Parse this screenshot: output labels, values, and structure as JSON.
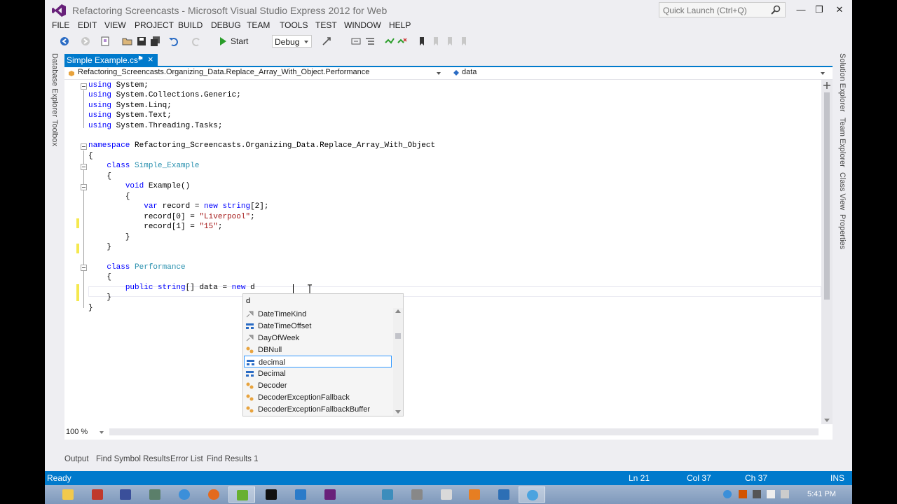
{
  "title": "Refactoring Screencasts - Microsoft Visual Studio Express 2012 for Web",
  "quick_launch_placeholder": "Quick Launch (Ctrl+Q)",
  "menu": [
    "FILE",
    "EDIT",
    "VIEW",
    "PROJECT",
    "BUILD",
    "DEBUG",
    "TEAM",
    "TOOLS",
    "TEST",
    "WINDOW",
    "HELP"
  ],
  "toolbar": {
    "start_label": "Start",
    "config": "Debug"
  },
  "left_tool_tabs": [
    "Database Explorer",
    "Toolbox"
  ],
  "right_tool_tabs": [
    "Solution Explorer",
    "Team Explorer",
    "Class View",
    "Properties"
  ],
  "document_tab": {
    "label": "Simple Example.cs*"
  },
  "navbar": {
    "type_dropdown": "Refactoring_Screencasts.Organizing_Data.Replace_Array_With_Object.Performance",
    "member_dropdown": "data"
  },
  "code": {
    "l1_kw": "using",
    "l1_rest": " System;",
    "l2_kw": "using",
    "l2_rest": " System.Collections.Generic;",
    "l3_kw": "using",
    "l3_rest": " System.Linq;",
    "l4_kw": "using",
    "l4_rest": " System.Text;",
    "l5_kw": "using",
    "l5_rest": " System.Threading.Tasks;",
    "l7_kw": "namespace",
    "l7_rest": " Refactoring_Screencasts.Organizing_Data.Replace_Array_With_Object",
    "l8": "{",
    "l9_kw": "class",
    "l9_type": "Simple_Example",
    "l10": "{",
    "l11_kw": "void",
    "l11_rest": " Example()",
    "l12": "{",
    "l13_kw1": "var",
    "l13_mid1": " record = ",
    "l13_kw2": "new",
    "l13_sp": " ",
    "l13_kw3": "string",
    "l13_end": "[2];",
    "l14_pre": "record[0] = ",
    "l14_str": "\"Liverpool\"",
    "l14_end": ";",
    "l15_pre": "record[1] = ",
    "l15_str": "\"15\"",
    "l15_end": ";",
    "l16": "}",
    "l17": "}",
    "l19_kw": "class",
    "l19_type": "Performance",
    "l20": "{",
    "l21_kw1": "public",
    "l21_sp": " ",
    "l21_kw2": "string",
    "l21_mid": "[] data = ",
    "l21_kw3": "new",
    "l21_end": " d",
    "l22": "}",
    "l23": "}"
  },
  "intellisense": {
    "typed": "d",
    "items": [
      {
        "label": "DateTimeKind",
        "icon": "enum-icon"
      },
      {
        "label": "DateTimeOffset",
        "icon": "struct-icon"
      },
      {
        "label": "DayOfWeek",
        "icon": "enum-icon"
      },
      {
        "label": "DBNull",
        "icon": "class-icon"
      },
      {
        "label": "decimal",
        "icon": "struct-icon",
        "selected": true
      },
      {
        "label": "Decimal",
        "icon": "struct-icon"
      },
      {
        "label": "Decoder",
        "icon": "class-icon"
      },
      {
        "label": "DecoderExceptionFallback",
        "icon": "class-icon"
      },
      {
        "label": "DecoderExceptionFallbackBuffer",
        "icon": "class-icon"
      }
    ]
  },
  "zoom": "100 %",
  "bottom_tabs": [
    "Output",
    "Find Symbol Results",
    "Error List",
    "Find Results 1"
  ],
  "status": {
    "ready": "Ready",
    "line": "Ln 21",
    "col": "Col 37",
    "ch": "Ch 37",
    "mode": "INS"
  },
  "clock": "5:41 PM",
  "colors": {
    "accent": "#007acc",
    "keyword": "#0000ff",
    "type": "#2b91af",
    "string": "#a31515",
    "vs_purple": "#68217a"
  }
}
